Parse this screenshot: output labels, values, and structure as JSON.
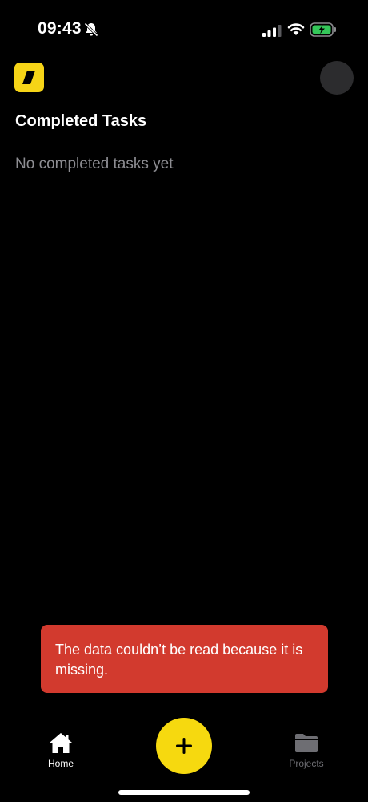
{
  "status_bar": {
    "time": "09:43"
  },
  "header": {
    "logo": "app-logo-slash",
    "avatar": "profile-avatar"
  },
  "main": {
    "title": "Completed Tasks",
    "empty_message": "No completed tasks yet"
  },
  "toast": {
    "message": "The data couldn’t be read because it is missing."
  },
  "tab_bar": {
    "home_label": "Home",
    "projects_label": "Projects",
    "add_icon": "plus-icon"
  },
  "colors": {
    "background": "#000000",
    "accent": "#f6d90f",
    "error": "#d23a2e",
    "muted_text": "#8e8e93"
  }
}
